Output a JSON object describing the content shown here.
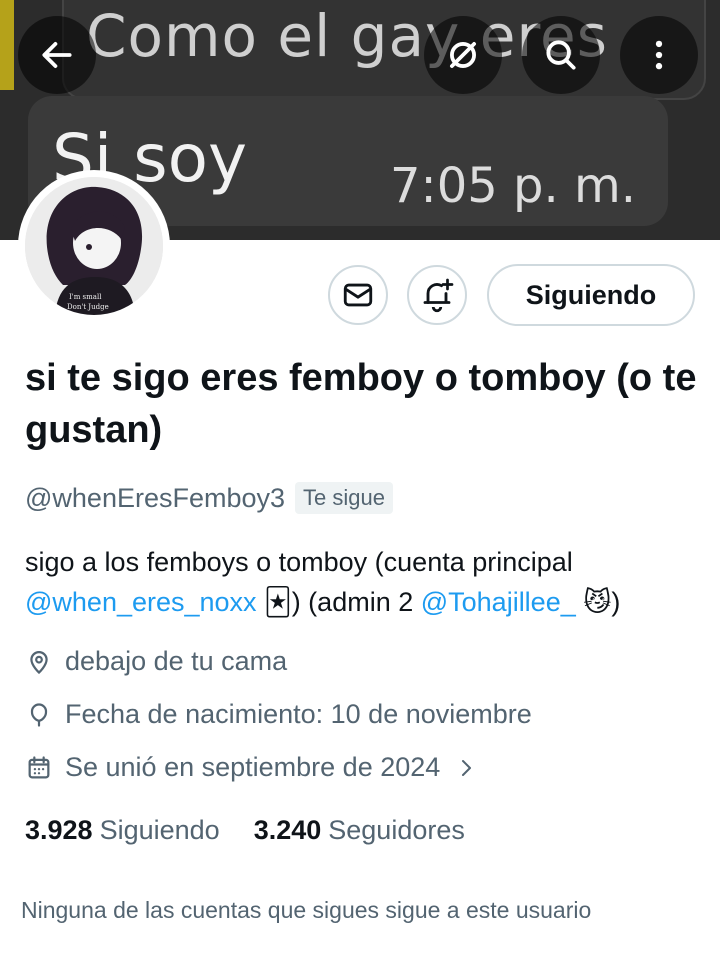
{
  "banner": {
    "line1": "Como el gay eres",
    "line2": "Si soy",
    "time": "7:05 p. m."
  },
  "topbar": {
    "back_icon": "arrow-left-icon",
    "mute_icon": "slashed-circle-icon",
    "search_icon": "search-icon",
    "more_icon": "more-vertical-icon"
  },
  "avatar": {
    "shirt_text": "I'm small Don't Judge"
  },
  "actions": {
    "message_icon": "envelope-icon",
    "notify_icon": "bell-plus-icon",
    "follow_label": "Siguiendo"
  },
  "profile": {
    "display_name": "si te sigo eres femboy o tomboy (o te gustan)",
    "handle": "@whenEresFemboy3",
    "follows_you": "Te sigue",
    "bio_part1": "sigo a los femboys o tomboy   (cuenta principal ",
    "bio_link1": "@when_eres_noxx",
    "bio_emoji1": "🃏",
    "bio_part2": ")  (admin 2 ",
    "bio_link2": "@Tohajillee_",
    "bio_emoji2": "😼",
    "bio_part3": ")",
    "location": "debajo de tu cama",
    "birthday": "Fecha de nacimiento: 10 de noviembre",
    "joined": "Se unió en septiembre de 2024"
  },
  "stats": {
    "following_count": "3.928",
    "following_label": "Siguiendo",
    "followers_count": "3.240",
    "followers_label": "Seguidores"
  },
  "footer_note": "Ninguna de las cuentas que sigues sigue a este usuario"
}
